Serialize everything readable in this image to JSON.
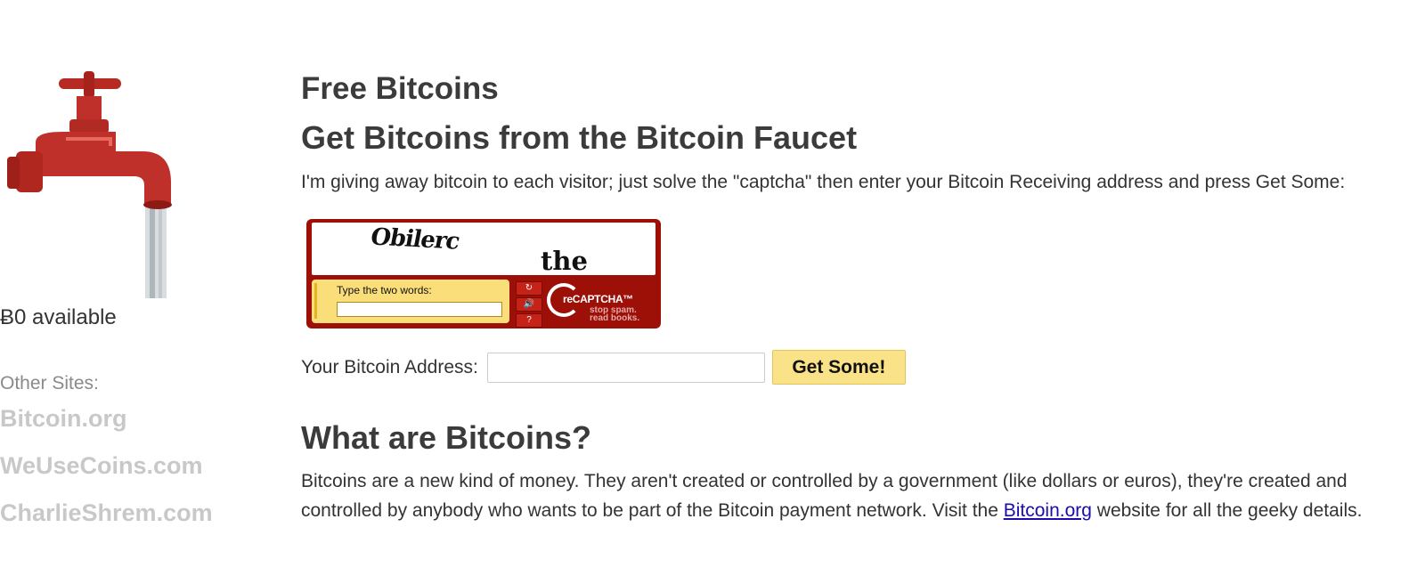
{
  "sidebar": {
    "available": "Ƀ0 available",
    "other_sites_title": "Other Sites:",
    "sites": [
      "Bitcoin.org",
      "WeUseCoins.com",
      "CharlieShrem.com"
    ]
  },
  "main": {
    "title": "Free Bitcoins",
    "subtitle": "Get Bitcoins from the Bitcoin Faucet",
    "intro": "I'm giving away bitcoin to each visitor; just solve the \"captcha\" then enter your Bitcoin Receiving address and press Get Some:",
    "captcha": {
      "word1": "Obilerc",
      "word2": "the",
      "entry_label": "Type the two words:",
      "logo_text": "reCAPTCHA™",
      "tag_line1": "stop spam.",
      "tag_line2": "read books."
    },
    "address_label": "Your Bitcoin Address:",
    "address_value": "",
    "button_label": "Get Some!",
    "what_heading": "What are Bitcoins?",
    "what_text_before": "Bitcoins are a new kind of money. They aren't created or controlled by a government (like dollars or euros), they're created and controlled by anybody who wants to be part of the Bitcoin payment network. Visit the ",
    "what_link": "Bitcoin.org",
    "what_text_after": " website for all the geeky details."
  },
  "colors": {
    "link_gray": "#c8c8c8",
    "button_yellow": "#f9e287",
    "captcha_red": "#9c1008",
    "faucet_red": "#c0302a"
  }
}
